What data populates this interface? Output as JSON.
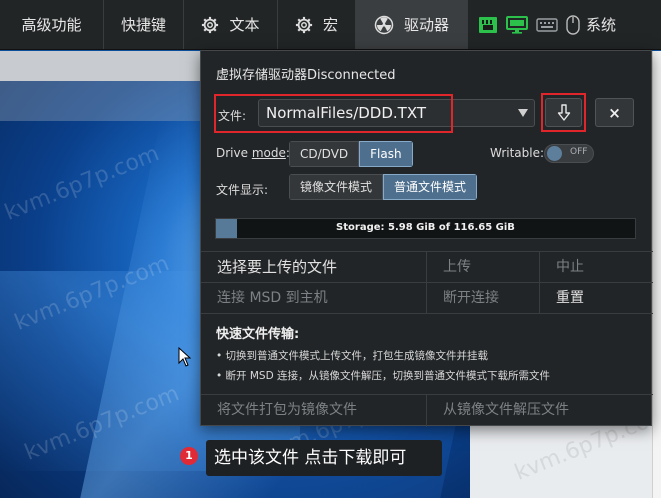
{
  "menubar": {
    "items": [
      {
        "label": "高级功能"
      },
      {
        "label": "快捷键"
      },
      {
        "label": "文本",
        "icon": "gear-icon"
      },
      {
        "label": "宏",
        "icon": "gear-icon"
      },
      {
        "label": "驱动器",
        "icon": "radiation-icon",
        "active": true
      },
      {
        "label": "系统"
      }
    ],
    "status_icons": [
      "network-icon",
      "monitor-icon",
      "keyboard-icon",
      "mouse-icon"
    ]
  },
  "panel": {
    "title": "虚拟存储驱动器Disconnected",
    "file_label": "文件:",
    "file_value": "NormalFiles/DDD.TXT",
    "close_label": "×",
    "drive_mode_prefix": "Drive ",
    "drive_mode_word": "mode",
    "drive_mode_suffix": ":",
    "drive_modes": [
      "CD/DVD",
      "Flash"
    ],
    "drive_mode_selected": "Flash",
    "writable_label": "Writable:",
    "writable_state": "OFF",
    "display_label": "文件显示:",
    "display_modes": [
      "镜像文件模式",
      "普通文件模式"
    ],
    "display_mode_selected": "普通文件模式",
    "storage_text": "Storage: 5.98 GiB of 116.65 GiB",
    "storage_used_gib": 5.98,
    "storage_total_gib": 116.65,
    "row1": {
      "select": "选择要上传的文件",
      "upload": "上传",
      "abort": "中止"
    },
    "row2": {
      "connect": "连接 MSD 到主机",
      "disconnect": "断开连接",
      "reset": "重置"
    },
    "quick_title": "快速文件传输:",
    "quick_lines": [
      "• 切换到普通文件模式上传文件，打包生成镜像文件并挂载",
      "• 断开 MSD 连接，从镜像文件解压，切换到普通文件模式下载所需文件"
    ],
    "row3": {
      "pack": "将文件打包为镜像文件",
      "unpack": "从镜像文件解压文件"
    }
  },
  "tip": {
    "number": "1",
    "text": "选中该文件 点击下载即可"
  },
  "watermark": "kvm.6p7p.com",
  "colors": {
    "highlight": "#e0262b",
    "accent": "#4e6f8d",
    "tip_badge": "#e02a35"
  }
}
